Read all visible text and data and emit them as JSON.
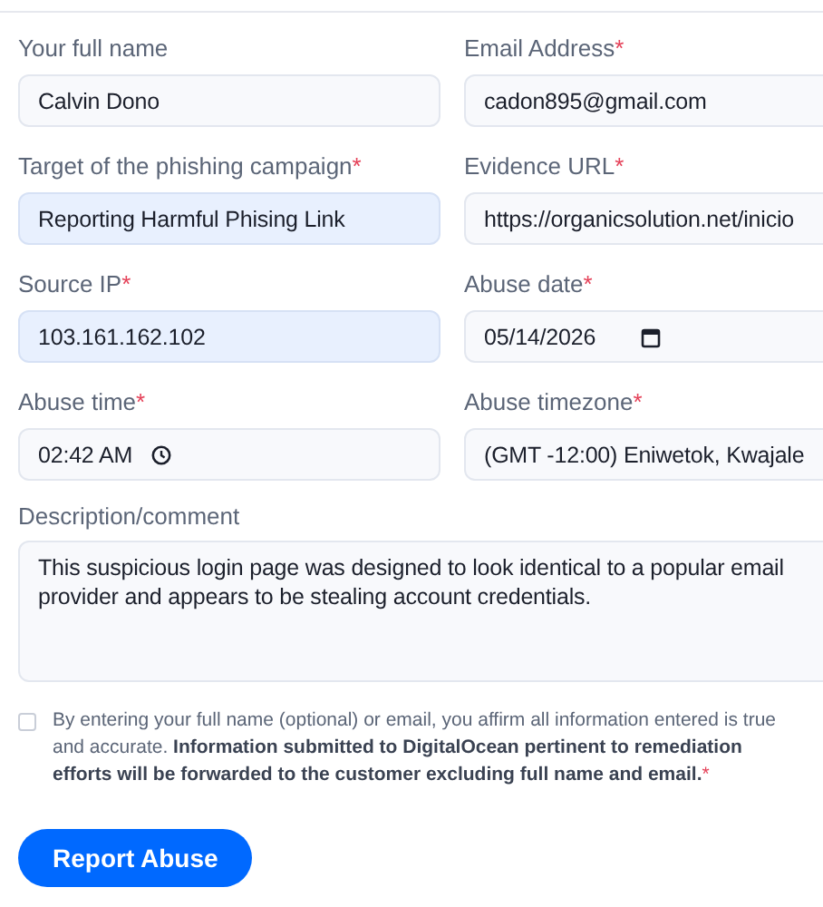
{
  "fields": [
    {
      "label": "Your full name",
      "kind": "text",
      "value": "Calvin Dono",
      "autofilled": false
    },
    {
      "label": "Email Address",
      "required_mark": "*",
      "kind": "text",
      "value": "cadon895@gmail.com",
      "autofilled": false
    },
    {
      "label": "Target of the phishing campaign",
      "required_mark": "*",
      "kind": "text",
      "value": "Reporting Harmful Phising Link",
      "autofilled": true
    },
    {
      "label": "Evidence URL",
      "required_mark": "*",
      "kind": "text",
      "value": "https://organicsolution.net/inicio",
      "autofilled": false
    },
    {
      "label": "Source IP",
      "required_mark": "*",
      "kind": "text",
      "value": "103.161.162.102",
      "autofilled": true
    },
    {
      "label": "Abuse date",
      "required_mark": "*",
      "kind": "date",
      "value": "05/14/2026",
      "autofilled": false
    },
    {
      "label": "Abuse time",
      "required_mark": "*",
      "kind": "time",
      "value": "02:42  AM",
      "autofilled": false
    },
    {
      "label": "Abuse timezone",
      "required_mark": "*",
      "kind": "select",
      "value": "(GMT -12:00) Eniwetok, Kwajale",
      "autofilled": false
    }
  ],
  "description": {
    "label": "Description/comment",
    "value": "This suspicious login page was designed to look identical to a popular email provider and appears to be stealing account credentials."
  },
  "consent": {
    "checked": false,
    "text": "By entering your full name (optional) or email, you affirm all information entered is true and accurate. **Information submitted to DigitalOcean pertinent to remediation efforts will be forwarded to the customer excluding full name and email.**",
    "required_mark": "*"
  },
  "submit_button": "Report Abuse"
}
